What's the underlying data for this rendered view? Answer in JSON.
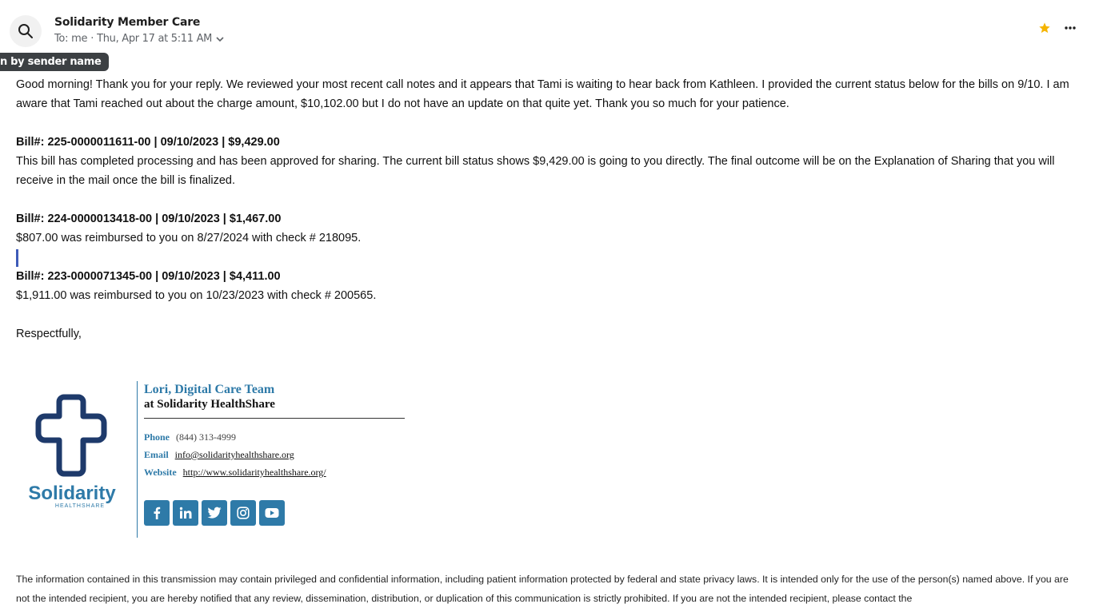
{
  "header": {
    "sender": "Solidarity Member Care",
    "to_label": "To:",
    "recipient": "me",
    "separator": "·",
    "date": "Thu, Apr 17 at 5:11 AM",
    "tooltip": "n by sender name"
  },
  "icons": {
    "search": "search-icon",
    "chevron": "chevron-down-icon",
    "star": "star-icon",
    "more": "more-horizontal-icon",
    "star_color": "#f5b400"
  },
  "body": {
    "intro": "Good morning! Thank you for your reply. We reviewed your most recent call notes and it appears that Tami is waiting to hear back from Kathleen. I provided the current status below for the bills on 9/10. I am aware that Tami reached out about the charge amount, $10,102.00 but I do not have an update on that quite yet. Thank you so much for your patience.",
    "bills": [
      {
        "heading": "Bill#: 225-0000011611-00 | 09/10/2023 | $9,429.00",
        "text": "This bill has completed processing and has been approved for sharing. The current bill status shows $9,429.00 is going to you directly. The final outcome will be on the Explanation of Sharing that you will receive in the mail once the bill is finalized."
      },
      {
        "heading": "Bill#: 224-0000013418-00 | 09/10/2023 | $1,467.00",
        "text": "$807.00 was reimbursed to you on 8/27/2024 with check # 218095."
      },
      {
        "heading": "Bill#: 223-0000071345-00 | 09/10/2023 | $4,411.00",
        "text": "$1,911.00 was reimbursed to you on 10/23/2023 with check # 200565."
      }
    ],
    "closing": "Respectfully,"
  },
  "signature": {
    "logo_text": "Solidarity",
    "logo_subtext": "HEALTHSHARE",
    "name": "Lori, Digital Care Team",
    "org": "at Solidarity HealthShare",
    "phone_label": "Phone",
    "phone": "(844) 313-4999",
    "email_label": "Email",
    "email": "info@solidarityhealthshare.org",
    "website_label": "Website",
    "website": "http://www.solidarityhealthshare.org/",
    "brand_color": "#2e7aa8",
    "logo_color": "#1e3a6b",
    "socials": [
      "facebook-icon",
      "linkedin-icon",
      "twitter-icon",
      "instagram-icon",
      "youtube-icon"
    ]
  },
  "disclaimer": "The information contained in this transmission may contain privileged and confidential information, including patient information protected by federal and state privacy laws. It is intended only for the use of the person(s) named above. If you are not the intended recipient, you are hereby notified that any review, dissemination, distribution, or duplication of this communication is strictly prohibited. If you are not the intended recipient, please contact the"
}
